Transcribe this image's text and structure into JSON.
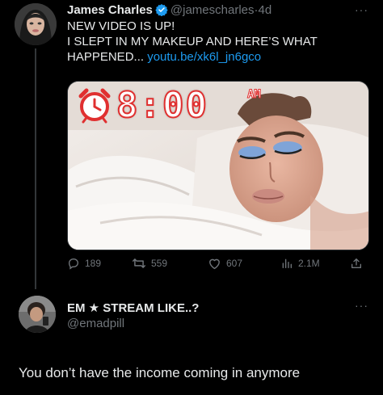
{
  "tweet": {
    "display_name": "James Charles",
    "handle": "@jamescharles",
    "separator": "·",
    "time": "4d",
    "more": "···",
    "text_line1": "NEW VIDEO IS UP!",
    "text_line2": "I SLEPT IN MY MAKEUP AND HERE’S WHAT",
    "text_line3_prefix": "HAPPENED... ",
    "link": "youtu.be/xk6l_jn6gco",
    "media": {
      "time_overlay": "8:00",
      "ampm": "AM",
      "description_icon": "alarm-clock-icon"
    },
    "actions": {
      "replies": "189",
      "retweets": "559",
      "likes": "607",
      "views": "2.1M"
    }
  },
  "reply": {
    "display_name": "EM ★ STREAM LIKE..?",
    "handle": "@emadpill",
    "more": "···",
    "text": "You don’t have the income coming in anymore"
  },
  "colors": {
    "background": "#000000",
    "text": "#e7e9ea",
    "muted": "#71767b",
    "link": "#1d9bf0",
    "verified": "#1d9bf0"
  }
}
